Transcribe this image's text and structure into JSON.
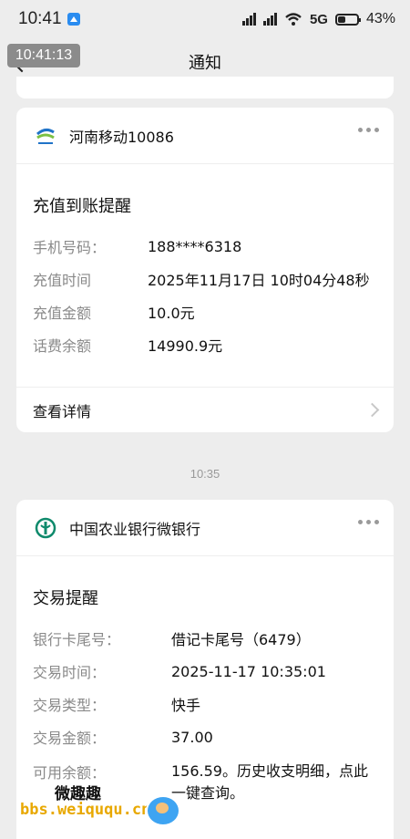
{
  "status_bar": {
    "time": "10:41",
    "network": "5G",
    "battery": "43%"
  },
  "time_overlay": "10:41:13",
  "header": {
    "title": "通知"
  },
  "cards": [
    {
      "source": "河南移动10086",
      "title": "充值到账提醒",
      "rows": [
        {
          "label": "手机号码：",
          "value": "188****6318"
        },
        {
          "label": "充值时间",
          "value": "2025年11月17日 10时04分48秒"
        },
        {
          "label": "充值金额",
          "value": "10.0元"
        },
        {
          "label": "话费余额",
          "value": "14990.9元"
        }
      ],
      "detail_label": "查看详情"
    },
    {
      "source": "中国农业银行微银行",
      "title": "交易提醒",
      "rows": [
        {
          "label": "银行卡尾号：",
          "value": "借记卡尾号（6479）"
        },
        {
          "label": "交易时间：",
          "value": "2025-11-17 10:35:01"
        },
        {
          "label": "交易类型：",
          "value": "快手"
        },
        {
          "label": "交易金额：",
          "value": "37.00"
        },
        {
          "label": "可用余额：",
          "value": "156.59。历史收支明细，点此一键查询。"
        }
      ]
    }
  ],
  "separator_time": "10:35",
  "watermark": {
    "text": "微趣趣",
    "url": "bbs.weiququ.cn"
  },
  "icons": {
    "logo_mobile": "china-mobile-logo-icon",
    "logo_bank": "abc-bank-logo-icon",
    "more": "more-dots-icon",
    "back": "back-arrow-icon",
    "chevron": "chevron-right-icon"
  },
  "colors": {
    "background": "#ededed",
    "card": "#ffffff",
    "label": "#8a8a8a",
    "bank_green": "#0f8a6c",
    "mobile_blue": "#1f73c8"
  }
}
